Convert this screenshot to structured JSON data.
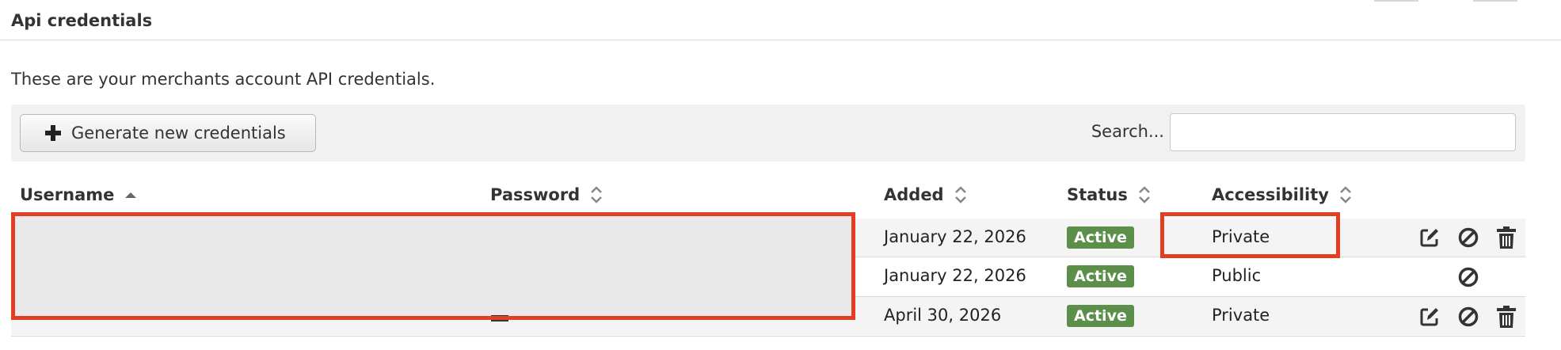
{
  "section": {
    "title": "Api credentials"
  },
  "intro": "These are your merchants account API credentials.",
  "toolbar": {
    "generate_label": "Generate new credentials",
    "search_label": "Search...",
    "search_value": ""
  },
  "table": {
    "columns": [
      "Username",
      "Password",
      "Added",
      "Status",
      "Accessibility"
    ],
    "sort": {
      "column": "Username",
      "direction": "ascending"
    },
    "rows": [
      {
        "added": "January 22, 2026",
        "status": "Active",
        "accessibility": "Private",
        "actions": [
          "edit-icon",
          "disable-icon",
          "trash-icon"
        ]
      },
      {
        "added": "January 22, 2026",
        "status": "Active",
        "accessibility": "Public",
        "actions": [
          "disable-icon"
        ]
      },
      {
        "added": "April 30, 2026",
        "status": "Active",
        "accessibility": "Private",
        "actions": [
          "edit-icon",
          "disable-icon",
          "trash-icon"
        ]
      }
    ]
  },
  "colors": {
    "status_active": "#5b8f4a",
    "annotation": "#e23e24",
    "redaction": "#e9e9e9"
  }
}
